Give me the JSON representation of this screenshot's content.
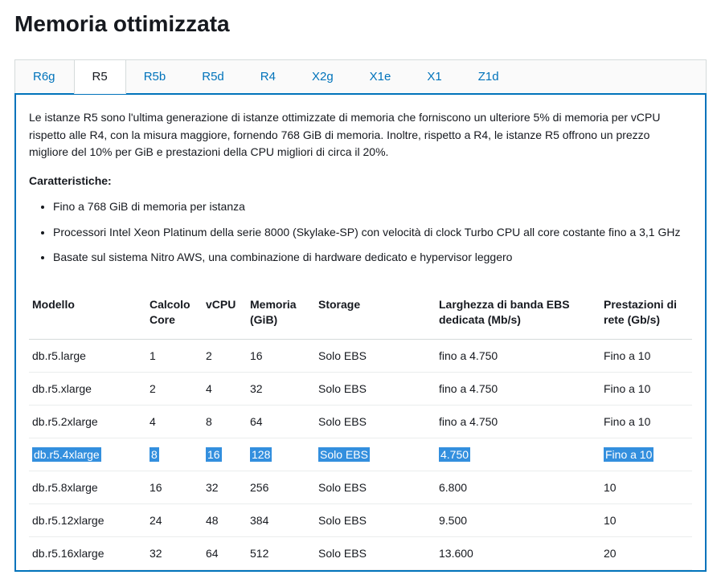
{
  "title": "Memoria ottimizzata",
  "tabs": [
    "R6g",
    "R5",
    "R5b",
    "R5d",
    "R4",
    "X2g",
    "X1e",
    "X1",
    "Z1d"
  ],
  "active_tab_index": 1,
  "description": "Le istanze R5 sono l'ultima generazione di istanze ottimizzate di memoria che forniscono un ulteriore 5% di memoria per vCPU rispetto alle R4, con la misura maggiore, fornendo 768 GiB di memoria. Inoltre, rispetto a R4, le istanze R5 offrono un prezzo migliore del 10% per GiB e prestazioni della CPU migliori di circa il 20%.",
  "features_title": "Caratteristiche:",
  "features": [
    "Fino a 768 GiB di memoria per istanza",
    "Processori Intel Xeon Platinum della serie 8000 (Skylake-SP) con velocità di clock Turbo CPU all core costante fino a 3,1 GHz",
    "Basate sul sistema Nitro AWS, una combinazione di hardware dedicato e hypervisor leggero"
  ],
  "columns": [
    "Modello",
    "Calcolo Core",
    "vCPU",
    "Memoria (GiB)",
    "Storage",
    "Larghezza di banda EBS dedicata (Mb/s)",
    "Prestazioni di rete (Gb/s)"
  ],
  "rows": [
    {
      "c": [
        "db.r5.large",
        "1",
        "2",
        "16",
        "Solo EBS",
        "fino a 4.750",
        "Fino a 10"
      ],
      "hl": false
    },
    {
      "c": [
        "db.r5.xlarge",
        "2",
        "4",
        "32",
        "Solo EBS",
        "fino a 4.750",
        "Fino a 10"
      ],
      "hl": false
    },
    {
      "c": [
        "db.r5.2xlarge",
        "4",
        "8",
        "64",
        "Solo EBS",
        "fino a 4.750",
        "Fino a 10"
      ],
      "hl": false
    },
    {
      "c": [
        "db.r5.4xlarge",
        "8",
        "16",
        "128",
        "Solo EBS",
        "4.750",
        "Fino a 10"
      ],
      "hl": true
    },
    {
      "c": [
        "db.r5.8xlarge",
        "16",
        "32",
        "256",
        "Solo EBS",
        "6.800",
        "10"
      ],
      "hl": false
    },
    {
      "c": [
        "db.r5.12xlarge",
        "24",
        "48",
        "384",
        "Solo EBS",
        "9.500",
        "10"
      ],
      "hl": false
    },
    {
      "c": [
        "db.r5.16xlarge",
        "32",
        "64",
        "512",
        "Solo EBS",
        "13.600",
        "20"
      ],
      "hl": false
    }
  ],
  "chart_data": {
    "type": "table",
    "columns": [
      "Modello",
      "Calcolo Core",
      "vCPU",
      "Memoria (GiB)",
      "Storage",
      "Larghezza di banda EBS dedicata (Mb/s)",
      "Prestazioni di rete (Gb/s)"
    ],
    "rows": [
      [
        "db.r5.large",
        1,
        2,
        16,
        "Solo EBS",
        "fino a 4.750",
        "Fino a 10"
      ],
      [
        "db.r5.xlarge",
        2,
        4,
        32,
        "Solo EBS",
        "fino a 4.750",
        "Fino a 10"
      ],
      [
        "db.r5.2xlarge",
        4,
        8,
        64,
        "Solo EBS",
        "fino a 4.750",
        "Fino a 10"
      ],
      [
        "db.r5.4xlarge",
        8,
        16,
        128,
        "Solo EBS",
        "4.750",
        "Fino a 10"
      ],
      [
        "db.r5.8xlarge",
        16,
        32,
        256,
        "Solo EBS",
        "6.800",
        "10"
      ],
      [
        "db.r5.12xlarge",
        24,
        48,
        384,
        "Solo EBS",
        "9.500",
        "10"
      ],
      [
        "db.r5.16xlarge",
        32,
        64,
        512,
        "Solo EBS",
        "13.600",
        "20"
      ]
    ]
  }
}
